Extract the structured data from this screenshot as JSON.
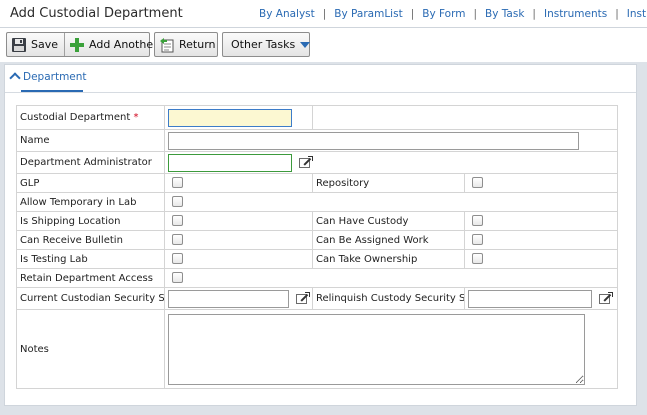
{
  "header": {
    "title": "Add Custodial Department",
    "links": [
      "By Analyst",
      "By ParamList",
      "By Form",
      "By Task",
      "Instruments",
      "Instrume"
    ]
  },
  "toolbar": {
    "save_label": "Save",
    "add_another_label": "Add Another",
    "return_label": "Return",
    "other_tasks_label": "Other Tasks"
  },
  "panel": {
    "tab_label": "Department"
  },
  "form": {
    "custodial_department": {
      "label": "Custodial Department",
      "required_mark": "*",
      "value": ""
    },
    "name": {
      "label": "Name",
      "value": ""
    },
    "department_administrator": {
      "label": "Department Administrator",
      "value": ""
    },
    "glp": {
      "label": "GLP",
      "checked": false
    },
    "repository": {
      "label": "Repository",
      "checked": false
    },
    "allow_temporary_in_lab": {
      "label": "Allow Temporary in Lab",
      "checked": false
    },
    "is_shipping_location": {
      "label": "Is Shipping Location",
      "checked": false
    },
    "can_have_custody": {
      "label": "Can Have Custody",
      "checked": false
    },
    "can_receive_bulletin": {
      "label": "Can Receive Bulletin",
      "checked": false
    },
    "can_be_assigned_work": {
      "label": "Can Be Assigned Work",
      "checked": false
    },
    "is_testing_lab": {
      "label": "Is Testing Lab",
      "checked": false
    },
    "can_take_ownership": {
      "label": "Can Take Ownership",
      "checked": false
    },
    "retain_department_access": {
      "label": "Retain Department Access",
      "checked": false
    },
    "current_custodian_security_set": {
      "label": "Current Custodian Security Set",
      "value": ""
    },
    "relinquish_custody_security_set": {
      "label": "Relinquish Custody Security Set",
      "value": ""
    },
    "notes": {
      "label": "Notes",
      "value": ""
    }
  },
  "colors": {
    "link": "#2a6ab3",
    "required": "#d0021b",
    "focused_input_bg": "#fcf8d2",
    "active_input_border": "#3c9a3c",
    "add_icon": "#3aa13a"
  },
  "icons": {
    "save": "floppy-disk-icon",
    "add_another": "plus-icon",
    "return": "return-document-icon",
    "other_tasks": "chevron-down-icon",
    "lookup": "external-lookup-icon"
  }
}
